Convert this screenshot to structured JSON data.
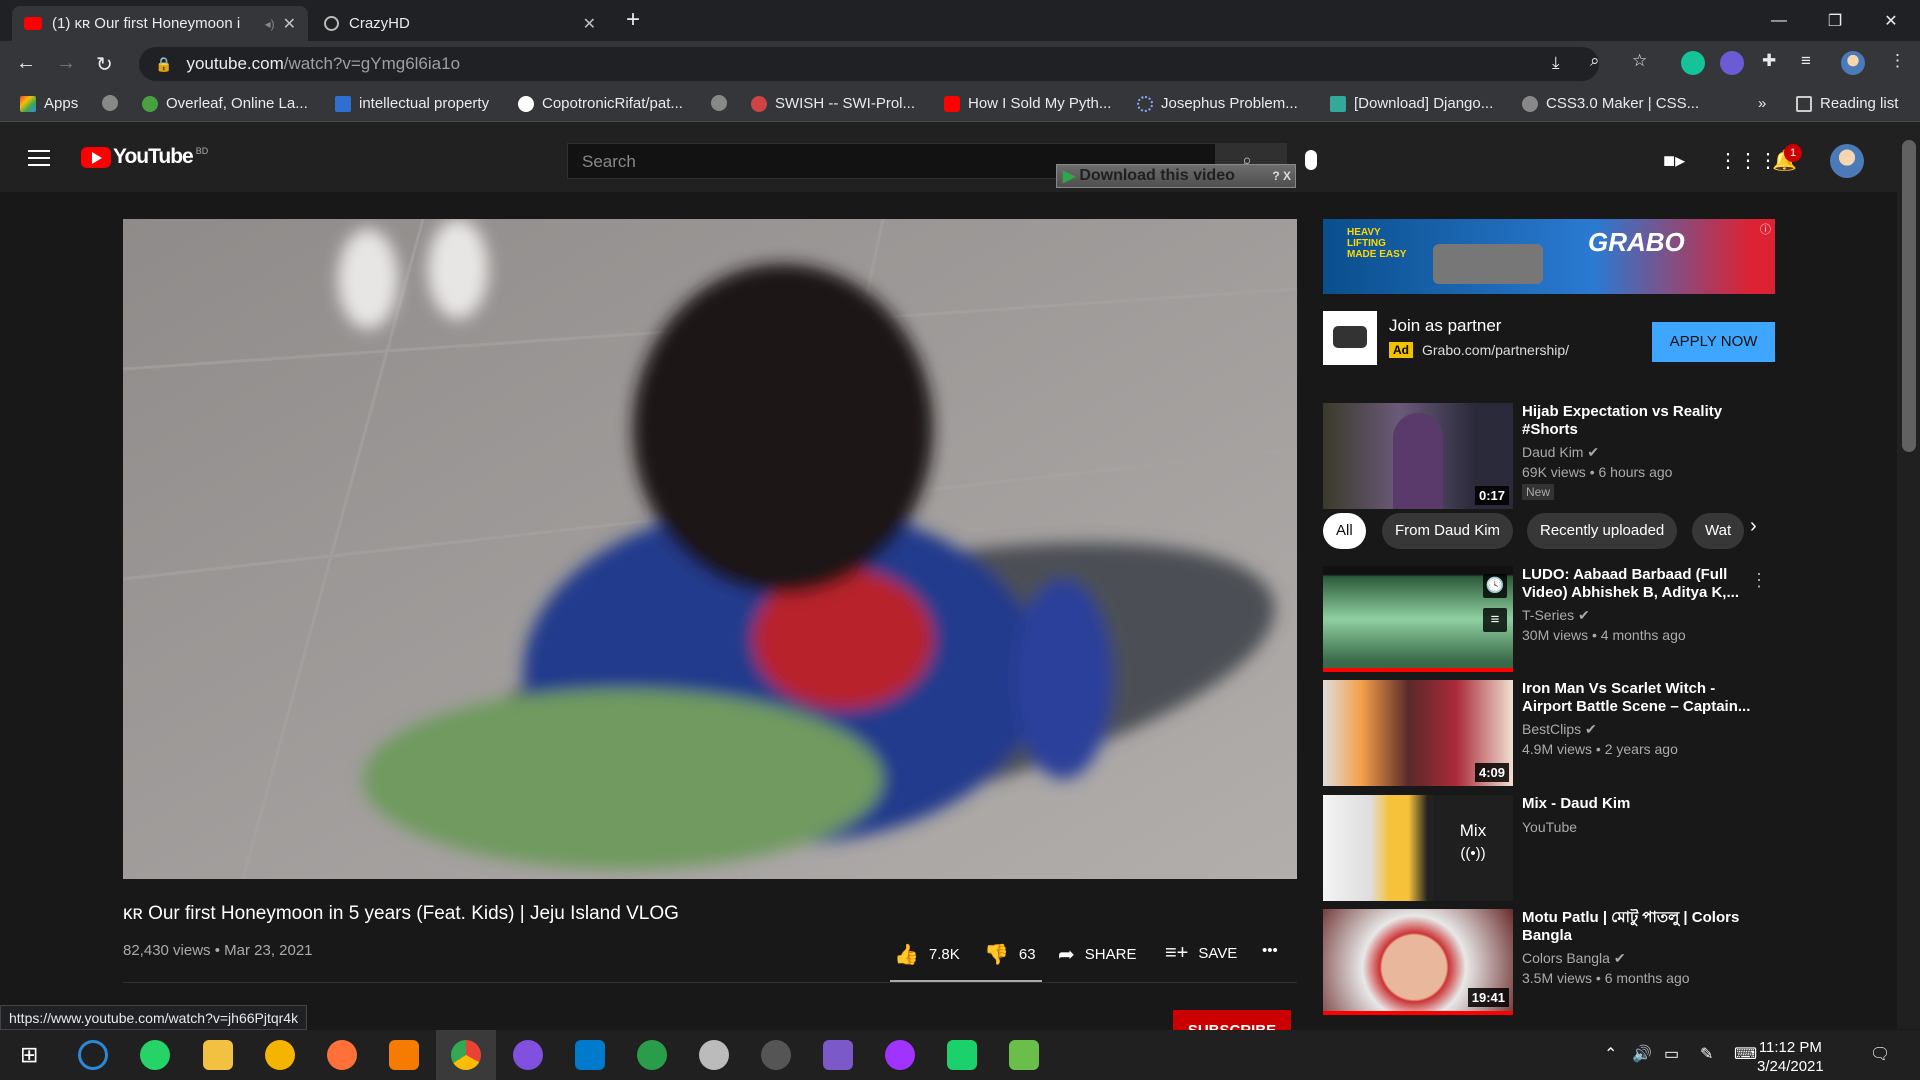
{
  "browser": {
    "tabs": [
      {
        "label": "(1) ᴋʀ Our first Honeymoon i",
        "active": true
      },
      {
        "label": "CrazyHD",
        "active": false
      }
    ],
    "url_host": "youtube.com",
    "url_path": "/watch?v=gYmg6l6ia1o",
    "bookmarks": [
      "Apps",
      "Overleaf, Online La...",
      "intellectual property",
      "CopotronicRifat/pat...",
      "SWISH -- SWI-Prol...",
      "How I Sold My Pyth...",
      "Josephus Problem...",
      "[Download] Django...",
      "CSS3.0 Maker | CSS..."
    ],
    "bookmarks_overflow": "»",
    "reading_list": "Reading list",
    "status_url": "https://www.youtube.com/watch?v=jh66Pjtqr4k"
  },
  "masthead": {
    "logo_text": "YouTube",
    "country_code": "BD",
    "search_placeholder": "Search",
    "download_bar": "Download this video",
    "download_help": "? X",
    "notification_count": "1"
  },
  "video": {
    "title": "ᴋʀ Our first Honeymoon in 5 years (Feat. Kids) | Jeju Island VLOG",
    "meta": "82,430 views • Mar 23, 2021",
    "likes": "7.8K",
    "dislikes": "63",
    "share": "SHARE",
    "save": "SAVE",
    "subscribe": "SUBSCRIBE"
  },
  "ad": {
    "banner_brand": "GRABO",
    "banner_tagline": "HEAVY LIFTING MADE EASY",
    "title": "Join as partner",
    "tag": "Ad",
    "url": "Grabo.com/partnership/",
    "cta": "APPLY NOW"
  },
  "chips": [
    "All",
    "From Daud Kim",
    "Recently uploaded",
    "Wat"
  ],
  "recommendations": [
    {
      "title": "Hijab Expectation vs Reality #Shorts",
      "channel": "Daud Kim",
      "verified": true,
      "meta": "69K views • 6 hours ago",
      "duration": "0:17",
      "badge": "New"
    },
    {
      "title": "LUDO: Aabaad Barbaad (Full Video) Abhishek B, Aditya K,...",
      "channel": "T-Series",
      "verified": true,
      "meta": "30M views • 4 months ago",
      "duration": "",
      "watched_fraction": 1.0
    },
    {
      "title": "Iron Man Vs Scarlet Witch - Airport Battle Scene – Captain...",
      "channel": "BestClips",
      "verified": true,
      "meta": "4.9M views • 2 years ago",
      "duration": "4:09"
    },
    {
      "title": "Mix - Daud Kim",
      "channel": "YouTube",
      "verified": false,
      "meta": "",
      "duration": "",
      "mix_label": "Mix"
    },
    {
      "title": "Motu Patlu | মোটু পাতলু | Colors Bangla",
      "channel": "Colors Bangla",
      "verified": true,
      "meta": "3.5M views • 6 months ago",
      "duration": "19:41",
      "watched_fraction": 1.0
    }
  ],
  "taskbar": {
    "time": "11:12 PM",
    "date": "3/24/2021"
  },
  "colors": {
    "youtube_red": "#ff0000",
    "subscribe_red": "#cc0000",
    "apply_blue": "#3ea6ff",
    "bg_dark": "#181818"
  }
}
